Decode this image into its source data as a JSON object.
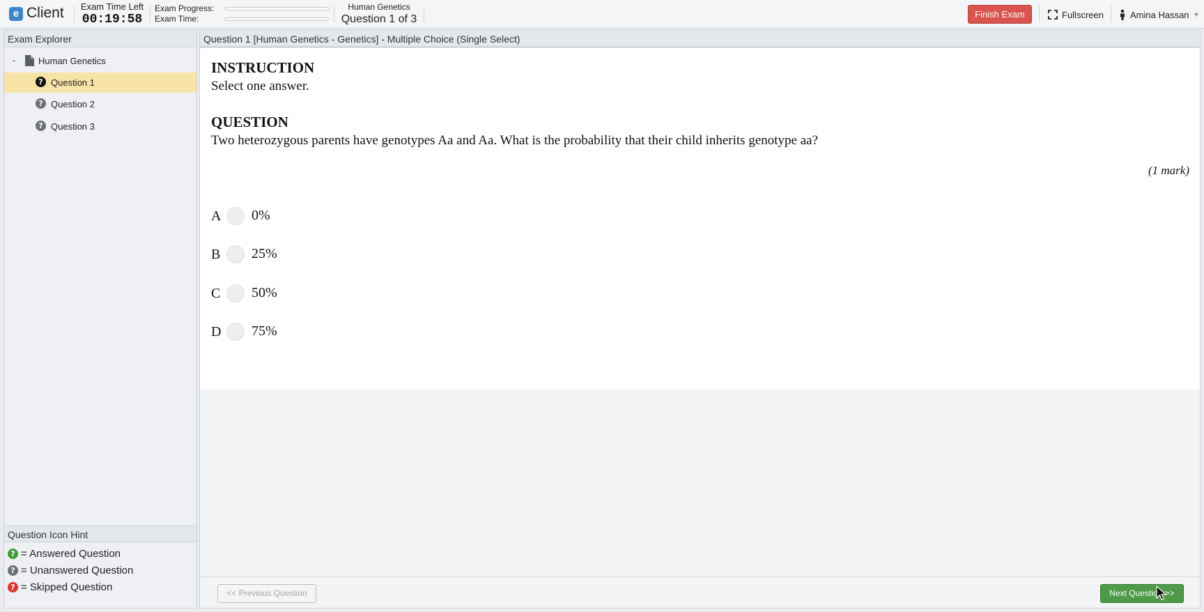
{
  "app": {
    "logo_letter": "e",
    "title": "Client"
  },
  "timer": {
    "label": "Exam Time Left",
    "value": "00:19:58"
  },
  "progress": {
    "progress_label": "Exam Progress:",
    "time_label": "Exam Time:",
    "progress_fraction": 0,
    "time_fraction": 0
  },
  "exam": {
    "topic": "Human Genetics",
    "counter": "Question 1 of 3"
  },
  "header_actions": {
    "finish_label": "Finish Exam",
    "fullscreen_label": "Fullscreen",
    "user_name": "Amina Hassan"
  },
  "sidebar": {
    "title": "Exam Explorer",
    "root_toggle": "-",
    "root_label": "Human Genetics",
    "items": [
      {
        "label": "Question 1",
        "status": "current"
      },
      {
        "label": "Question 2",
        "status": "unanswered"
      },
      {
        "label": "Question 3",
        "status": "unanswered"
      }
    ],
    "hint_title": "Question Icon Hint",
    "hints": [
      {
        "text": "= Answered Question"
      },
      {
        "text": "= Unanswered Question"
      },
      {
        "text": "= Skipped Question"
      }
    ]
  },
  "main": {
    "header": "Question 1 [Human Genetics - Genetics] - Multiple Choice (Single Select)",
    "instruction_title": "INSTRUCTION",
    "instruction_text": "Select one answer.",
    "question_title": "QUESTION",
    "question_text": "Two heterozygous parents have genotypes Aa and Aa. What is the probability that their child inherits genotype aa?",
    "marks": "(1 mark)",
    "options": [
      {
        "letter": "A",
        "text": "0%"
      },
      {
        "letter": "B",
        "text": "25%"
      },
      {
        "letter": "C",
        "text": "50%"
      },
      {
        "letter": "D",
        "text": "75%"
      }
    ]
  },
  "footer": {
    "prev_label": "<< Previous Question",
    "next_label": "Next Question >>"
  },
  "colors": {
    "accent": "#3f86c8",
    "finish": "#d9534f",
    "next": "#4e9a48",
    "active_item": "#f7e3a6",
    "answered": "#3f9b3a",
    "skipped": "#d9372e"
  }
}
